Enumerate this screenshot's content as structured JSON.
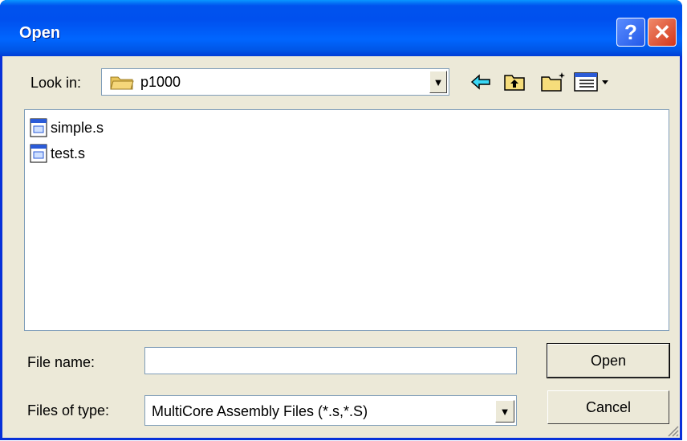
{
  "window": {
    "title": "Open",
    "help_glyph": "?",
    "close_glyph": "✕"
  },
  "lookin": {
    "label": "Look in:",
    "value": "p1000",
    "icon": "folder-icon"
  },
  "toolbar": {
    "icons": [
      "back-icon",
      "up-folder-icon",
      "new-folder-icon",
      "view-menu-icon"
    ]
  },
  "files": [
    {
      "name": "simple.s",
      "icon": "assembly-file-icon"
    },
    {
      "name": "test.s",
      "icon": "assembly-file-icon"
    }
  ],
  "filename": {
    "label": "File name:",
    "value": ""
  },
  "filetype": {
    "label": "Files of type:",
    "value": "MultiCore Assembly Files (*.s,*.S)"
  },
  "buttons": {
    "open": "Open",
    "cancel": "Cancel"
  },
  "colors": {
    "title_bar": "#0054e3",
    "dialog_bg": "#ece9d8",
    "close_button": "#d2361b"
  }
}
